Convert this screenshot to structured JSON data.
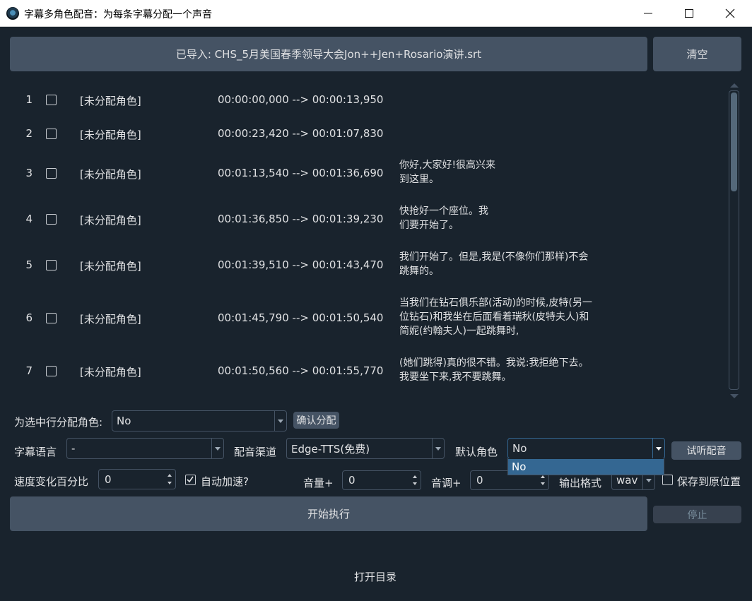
{
  "window": {
    "title": "字幕多角色配音：为每条字幕分配一个声音"
  },
  "header": {
    "imported_label": "已导入: CHS_5月美国春季领导大会Jon++Jen+Rosario演讲.srt",
    "clear_button": "清空"
  },
  "rows": [
    {
      "num": "1",
      "role": "[未分配角色]",
      "time": "00:00:00,000 --> 00:00:13,950",
      "text": ""
    },
    {
      "num": "2",
      "role": "[未分配角色]",
      "time": "00:00:23,420 --> 00:01:07,830",
      "text": ""
    },
    {
      "num": "3",
      "role": "[未分配角色]",
      "time": "00:01:13,540 --> 00:01:36,690",
      "text": "你好,大家好!很高兴来\n到这里。"
    },
    {
      "num": "4",
      "role": "[未分配角色]",
      "time": "00:01:36,850 --> 00:01:39,230",
      "text": "快抢好一个座位。我\n们要开始了。"
    },
    {
      "num": "5",
      "role": "[未分配角色]",
      "time": "00:01:39,510 --> 00:01:43,470",
      "text": "我们开始了。但是,我是(不像你们那样)不会\n跳舞的。"
    },
    {
      "num": "6",
      "role": "[未分配角色]",
      "time": "00:01:45,790 --> 00:01:50,540",
      "text": "当我们在钻石俱乐部(活动)的时候,皮特(另一\n位钻石)和我坐在后面看着瑞秋(皮特夫人)和\n简妮(约翰夫人)一起跳舞时,"
    },
    {
      "num": "7",
      "role": "[未分配角色]",
      "time": "00:01:50,560 --> 00:01:55,770",
      "text": "(她们跳得)真的很不错。我说:我拒绝下去。\n我要坐下来,我不要跳舞。"
    }
  ],
  "assign": {
    "label": "为选中行分配角色:",
    "value": "No",
    "confirm_button": "确认分配"
  },
  "settings": {
    "subtitle_lang_label": "字幕语言",
    "subtitle_lang_value": "-",
    "channel_label": "配音渠道",
    "channel_value": "Edge-TTS(免费)",
    "default_role_label": "默认角色",
    "default_role_value": "No",
    "preview_button": "试听配音",
    "dropdown_options": [
      "No"
    ],
    "speed_label": "速度变化百分比",
    "speed_value": "0",
    "auto_speed_label": "自动加速?",
    "volume_label": "音量+",
    "volume_value": "0",
    "pitch_label": "音调+",
    "pitch_value": "0",
    "format_label": "输出格式",
    "format_value": "wav",
    "save_in_place_label": "保存到原位置"
  },
  "actions": {
    "start_button": "开始执行",
    "stop_button": "停止",
    "open_dir_link": "打开目录"
  }
}
